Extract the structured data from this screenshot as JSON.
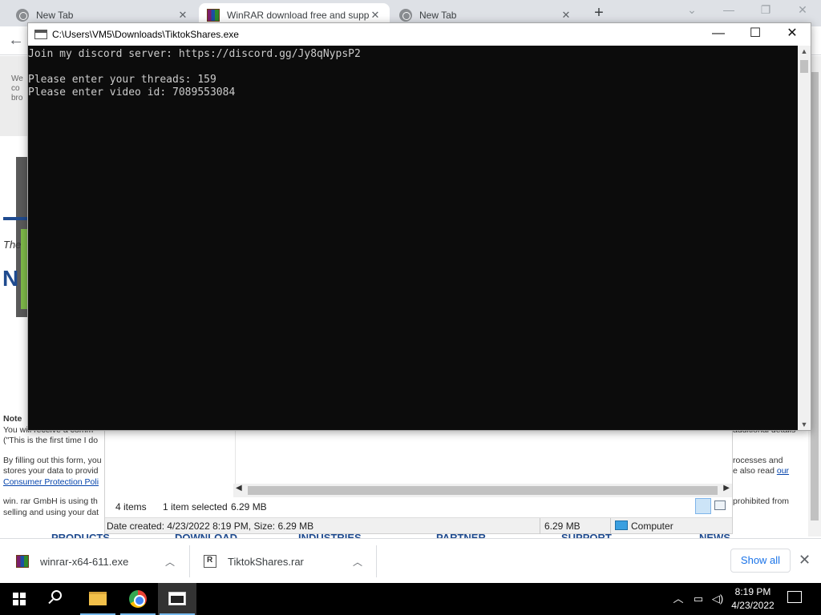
{
  "browser": {
    "tabs": [
      {
        "title": "New Tab",
        "active": false,
        "icon": "chrome-icon"
      },
      {
        "title": "WinRAR download free and supp",
        "active": true,
        "icon": "winrar-icon"
      },
      {
        "title": "New Tab",
        "active": false,
        "icon": "chrome-icon"
      }
    ],
    "new_tab_glyph": "+",
    "close_glyph": "✕"
  },
  "page": {
    "the_text": "The",
    "big_letter": "N",
    "note_label": "Note",
    "line1": "You will receive a comm",
    "line2": "(\"This is the first time I do",
    "line3": "By filling out this form, you",
    "line4": "stores your data to provid",
    "link1": "Consumer Protection Poli",
    "line5": "win. rar GmbH is using th",
    "line6": "selling and using your dat",
    "right1": "additional details",
    "right2": "rocesses and",
    "right3": "e also read ",
    "right3_link": "our",
    "right4": "prohibited from",
    "footer": [
      "PRODUCTS",
      "DOWNLOAD",
      "INDUSTRIES",
      "PARTNER",
      "SUPPORT",
      "NEWS"
    ]
  },
  "explorer": {
    "items_count": "4 items",
    "selected": "1 item selected",
    "selected_size": "6.29 MB",
    "details_date": "Date created: 4/23/2022 8:19 PM, Size: 6.29 MB",
    "details_size": "6.29 MB",
    "details_location": "Computer"
  },
  "console": {
    "title": "C:\\Users\\VM5\\Downloads\\TiktokShares.exe",
    "lines": [
      "Join my discord server: https://discord.gg/Jy8qNypsP2",
      "",
      "Please enter your threads: 159",
      "Please enter video id: 7089553084"
    ]
  },
  "downloads": {
    "items": [
      {
        "name": "winrar-x64-611.exe",
        "icon": "winrar-icon"
      },
      {
        "name": "TiktokShares.rar",
        "icon": "rar-file-icon"
      }
    ],
    "show_all": "Show all"
  },
  "taskbar": {
    "time": "8:19 PM",
    "date": "4/23/2022"
  },
  "colors": {
    "console_bg": "#0c0c0c",
    "console_text": "#cccccc",
    "link": "#1a73e8",
    "taskbar": "#000000"
  }
}
